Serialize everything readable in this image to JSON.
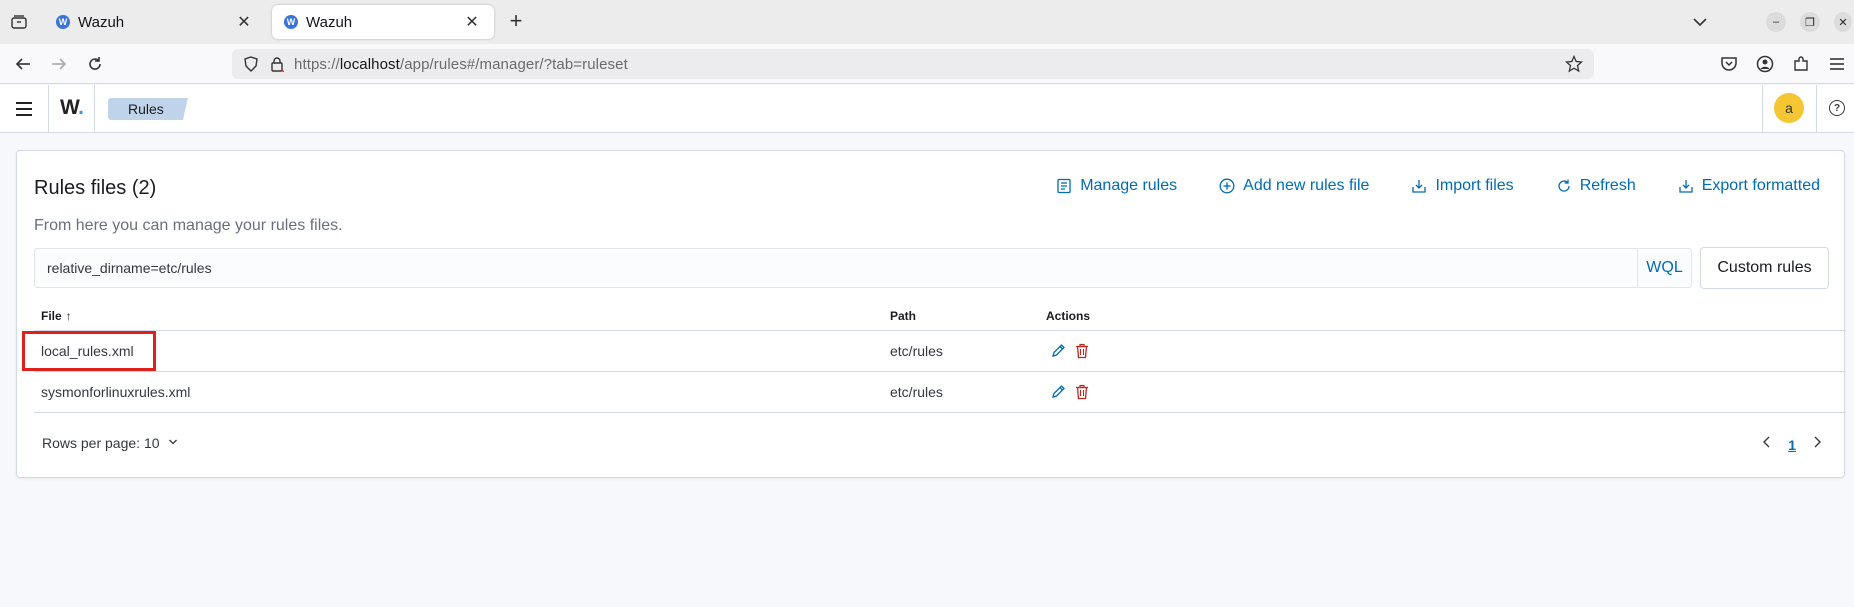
{
  "browser": {
    "tabs": [
      {
        "title": "Wazuh",
        "active": false
      },
      {
        "title": "Wazuh",
        "active": true
      }
    ],
    "url_prefix": "https://",
    "url_host": "localhost",
    "url_path": "/app/rules#/manager/?tab=ruleset"
  },
  "app": {
    "logo_text": "W",
    "breadcrumb": "Rules",
    "avatar_letter": "a",
    "help_label": "?"
  },
  "panel": {
    "title": "Rules files (2)",
    "description": "From here you can manage your rules files.",
    "actions": {
      "manage": "Manage rules",
      "add": "Add new rules file",
      "import": "Import files",
      "refresh": "Refresh",
      "export": "Export formatted"
    },
    "search": {
      "value": "relative_dirname=etc/rules",
      "language": "WQL"
    },
    "custom_button": "Custom rules",
    "table": {
      "columns": {
        "file": "File",
        "path": "Path",
        "actions": "Actions"
      },
      "sort_indicator": "↑",
      "rows": [
        {
          "file": "local_rules.xml",
          "path": "etc/rules"
        },
        {
          "file": "sysmonforlinuxrules.xml",
          "path": "etc/rules"
        }
      ]
    },
    "pagination": {
      "rows_per_page": "Rows per page: 10",
      "current_page": "1"
    }
  },
  "colors": {
    "link": "#006bb8",
    "highlight": "#e0201c",
    "delete": "#bd271e"
  }
}
